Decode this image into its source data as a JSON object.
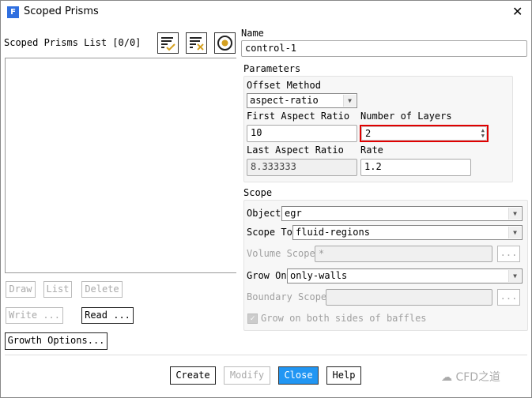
{
  "window": {
    "title": "Scoped Prisms",
    "app_icon": "F"
  },
  "list": {
    "label": "Scoped Prisms List [0/0]",
    "buttons": {
      "draw": "Draw",
      "list": "List",
      "delete": "Delete",
      "write": "Write ...",
      "read": "Read ...",
      "growth": "Growth Options..."
    }
  },
  "name": {
    "label": "Name",
    "value": "control-1"
  },
  "parameters": {
    "label": "Parameters",
    "offset_method_label": "Offset Method",
    "offset_method": "aspect-ratio",
    "first_ar_label": "First Aspect Ratio",
    "first_ar": "10",
    "layers_label": "Number of Layers",
    "layers": "2",
    "last_ar_label": "Last Aspect Ratio",
    "last_ar": "8.333333",
    "rate_label": "Rate",
    "rate": "1.2"
  },
  "scope": {
    "label": "Scope",
    "object_label": "Object",
    "object": "egr",
    "scope_to_label": "Scope To",
    "scope_to": "fluid-regions",
    "volume_scope_label": "Volume Scope",
    "volume_scope": "*",
    "grow_on_label": "Grow On",
    "grow_on": "only-walls",
    "boundary_scope_label": "Boundary Scope",
    "boundary_scope": "",
    "browse": "...",
    "baffles_label": "Grow on both sides of baffles"
  },
  "footer": {
    "create": "Create",
    "modify": "Modify",
    "close": "Close",
    "help": "Help",
    "watermark": "CFD之道"
  },
  "colors": {
    "accent": "#2196f3",
    "highlight": "#e00000",
    "icon_gold": "#d4a020"
  }
}
